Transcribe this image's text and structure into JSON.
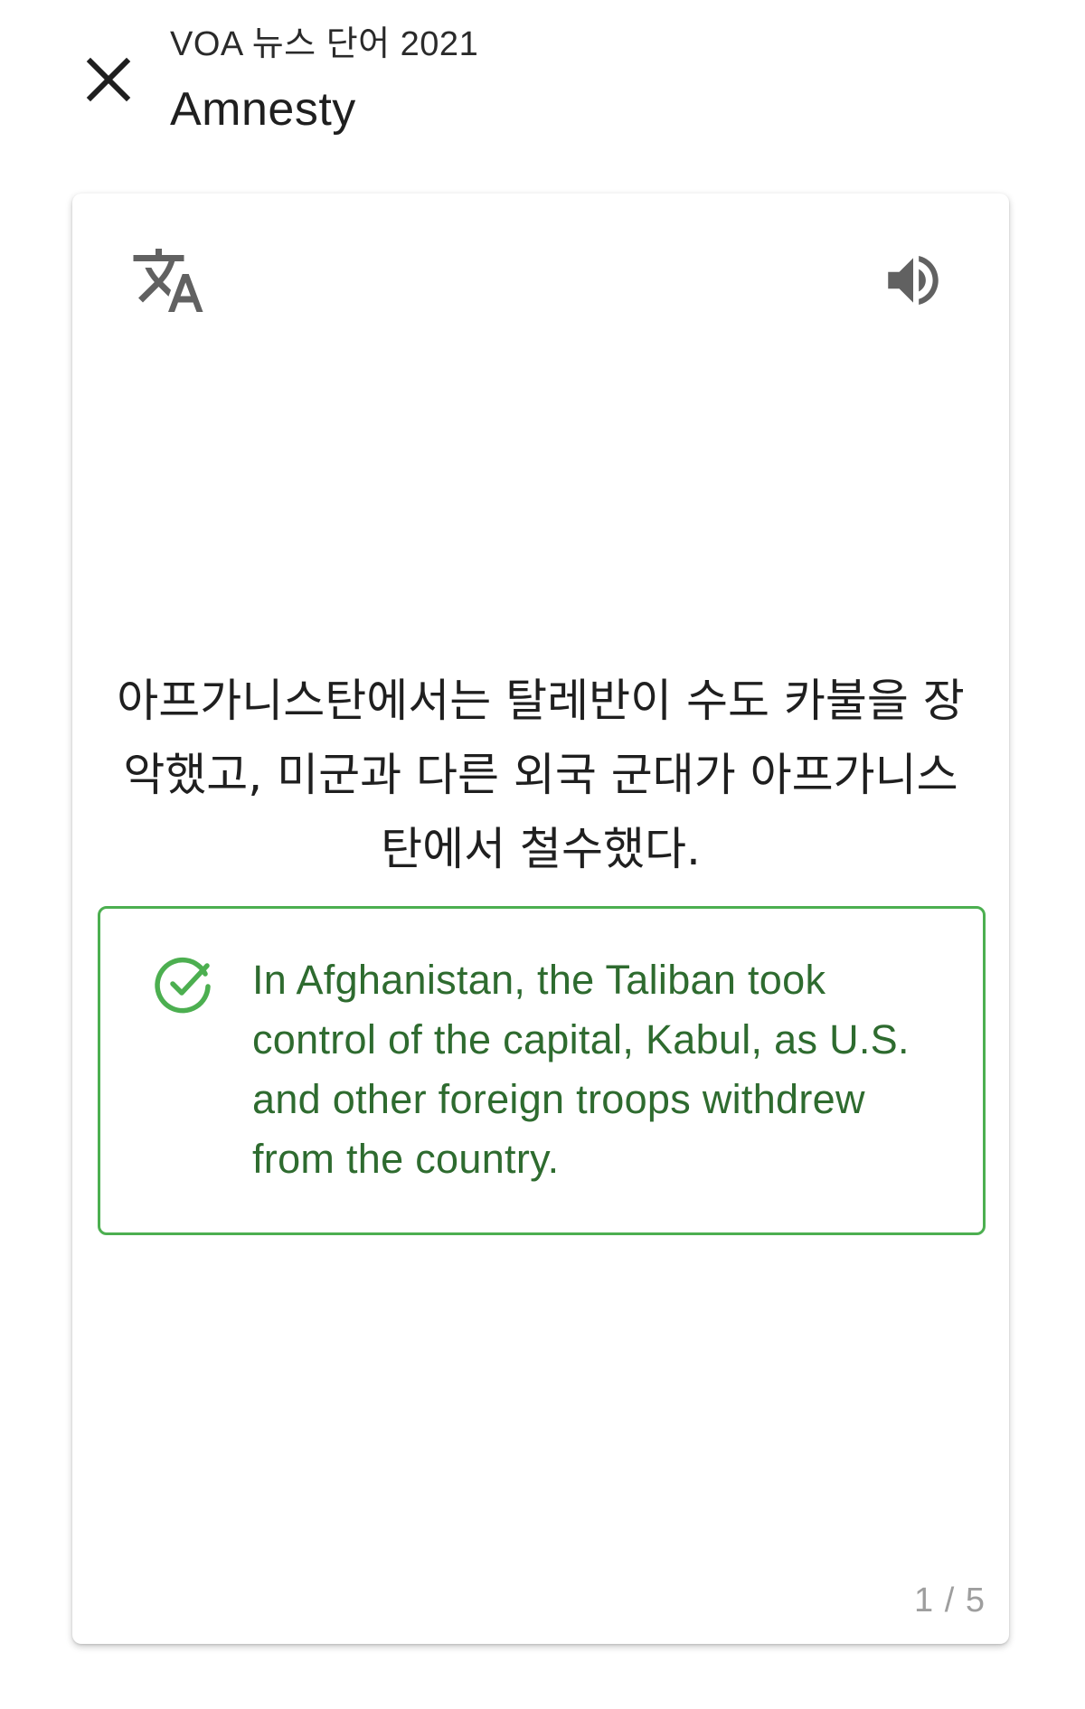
{
  "header": {
    "deck_name": "VOA 뉴스 단어 2021",
    "word": "Amnesty",
    "close_icon": "close-icon"
  },
  "card": {
    "translate_icon": "translate-icon",
    "speaker_icon": "volume-up-icon",
    "sentence_ko": "아프가니스탄에서는 탈레반이 수도 카불을 장악했고, 미군과 다른 외국 군대가 아프가니스탄에서 철수했다.",
    "answer": {
      "status_icon": "check-circle-icon",
      "text_en": "In Afghanistan, the Taliban took control of the capital, Kabul, as U.S. and other foreign troops withdrew from the country.",
      "accent_color": "#4caf50",
      "text_color": "#2e6b2f"
    },
    "page_indicator": "1 / 5"
  }
}
